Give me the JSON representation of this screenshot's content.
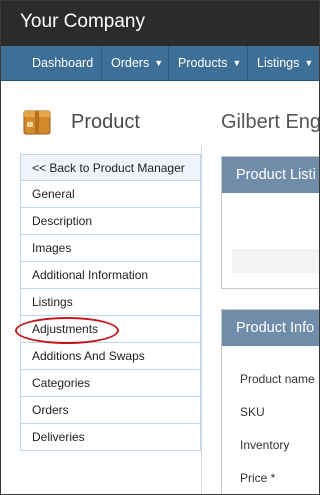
{
  "brand": {
    "name": "Your Company"
  },
  "nav": {
    "items": [
      {
        "label": "Dashboard"
      },
      {
        "label": "Orders"
      },
      {
        "label": "Products"
      },
      {
        "label": "Listings"
      }
    ]
  },
  "page": {
    "icon": "product-box-icon",
    "title": "Product",
    "customer_title": "Gilbert Engl"
  },
  "sidebar": {
    "items": [
      {
        "label": "<< Back to Product Manager"
      },
      {
        "label": "General"
      },
      {
        "label": "Description"
      },
      {
        "label": "Images"
      },
      {
        "label": "Additional Information"
      },
      {
        "label": "Listings"
      },
      {
        "label": "Adjustments"
      },
      {
        "label": "Additions And Swaps"
      },
      {
        "label": "Categories"
      },
      {
        "label": "Orders"
      },
      {
        "label": "Deliveries"
      }
    ],
    "highlighted": "Adjustments"
  },
  "panels": {
    "listing": {
      "title": "Product Listi"
    },
    "info": {
      "title": "Product Info",
      "fields": [
        {
          "label": "Product name"
        },
        {
          "label": "SKU"
        },
        {
          "label": "Inventory"
        },
        {
          "label": "Price *"
        }
      ]
    }
  },
  "colors": {
    "topbar": "#2b2b2b",
    "navbar": "#3d6f97",
    "panel_header": "#6f8ca8",
    "highlight_ellipse": "#c4161c",
    "sidebar_border": "#bfd7ea"
  }
}
